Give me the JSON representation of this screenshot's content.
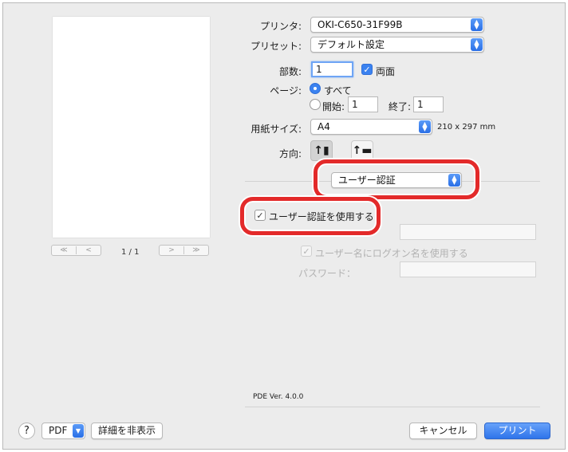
{
  "preview": {
    "page_indicator": "1 / 1",
    "first_label": "≪",
    "prev_label": "<",
    "next_label": ">",
    "last_label": "≫"
  },
  "printer": {
    "label": "プリンタ:",
    "value": "OKI-C650-31F99B"
  },
  "preset": {
    "label": "プリセット:",
    "value": "デフォルト設定"
  },
  "copies": {
    "label": "部数:",
    "value": "1",
    "duplex_label": "両面",
    "duplex_checked": true
  },
  "pages": {
    "label": "ページ:",
    "all_label": "すべて",
    "from_label": "開始:",
    "from_value": "1",
    "to_label": "終了:",
    "to_value": "1"
  },
  "paper": {
    "label": "用紙サイズ:",
    "value": "A4",
    "dimensions": "210 x 297 mm"
  },
  "orientation": {
    "label": "方向:"
  },
  "section": {
    "value": "ユーザー認証"
  },
  "auth": {
    "use_auth_label": "ユーザー認証を使用する",
    "use_auth_checked": true,
    "logon_label": "ユーザー名にログオン名を使用する",
    "password_label": "パスワード："
  },
  "version": "PDE Ver. 4.0.0",
  "footer": {
    "help_label": "?",
    "pdf_label": "PDF",
    "hide_details_label": "詳細を非表示",
    "cancel_label": "キャンセル",
    "print_label": "プリント"
  },
  "colors": {
    "accent": "#3b82f0",
    "highlight": "#e32a2a"
  }
}
